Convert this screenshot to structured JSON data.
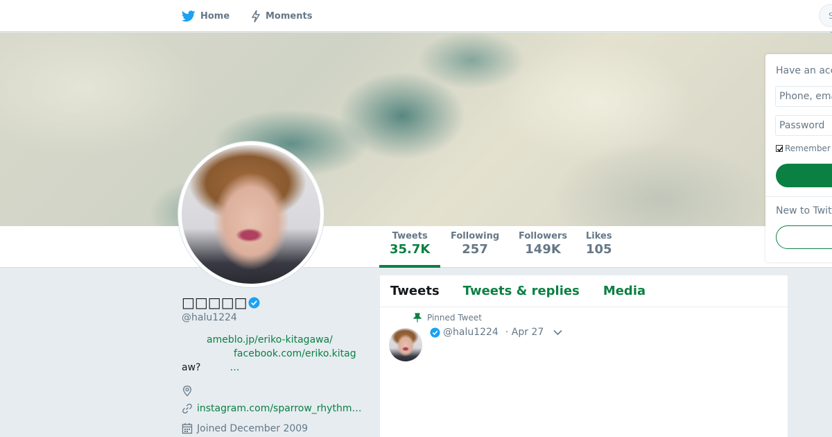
{
  "nav": {
    "home_label": "Home",
    "moments_label": "Moments",
    "search_placeholder": "S",
    "edge_text": "I"
  },
  "profile": {
    "display_name": "□□□□□",
    "handle": "@halu1224",
    "bio_link_1": "ameblo.jp/eriko-kitagawa/",
    "bio_link_2": "facebook.com/eriko.kitag",
    "bio_text_3": "aw?",
    "bio_ellipsis": "…",
    "website": "instagram.com/sparrow_rhythm…",
    "joined": "Joined December 2009"
  },
  "stats": [
    {
      "label": "Tweets",
      "value": "35.7K"
    },
    {
      "label": "Following",
      "value": "257"
    },
    {
      "label": "Followers",
      "value": "149K"
    },
    {
      "label": "Likes",
      "value": "105"
    }
  ],
  "timeline": {
    "tabs": [
      "Tweets",
      "Tweets & replies",
      "Media"
    ],
    "pinned_label": "Pinned Tweet",
    "tweet_handle": "@halu1224",
    "tweet_date": "· Apr 27"
  },
  "login": {
    "title": "Have an account?",
    "phone_placeholder": "Phone, email or username",
    "password_placeholder": "Password",
    "remember_label": "Remember me",
    "new_title": "New to Twitter?"
  },
  "colors": {
    "accent": "#0a8043",
    "verified": "#1da1f2",
    "muted": "#657786"
  }
}
